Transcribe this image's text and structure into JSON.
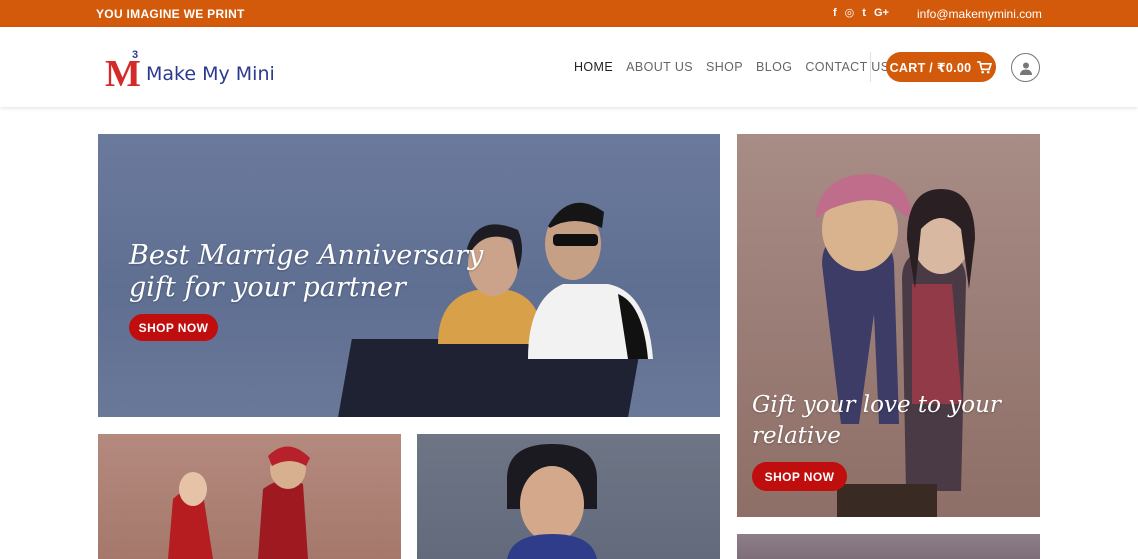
{
  "topbar": {
    "tagline": "YOU IMAGINE WE PRINT",
    "social_icons": [
      "facebook-icon",
      "instagram-icon",
      "twitter-icon",
      "google-plus-icon"
    ],
    "social_glyphs": [
      "f",
      "◎",
      "t",
      "G+"
    ],
    "email": "info@makemymini.com",
    "bg_color": "#d35a0b"
  },
  "logo": {
    "mark": "M",
    "superscript": "3",
    "text": "Make My Mini"
  },
  "nav": {
    "items": [
      {
        "label": "HOME",
        "active": true
      },
      {
        "label": "ABOUT US",
        "active": false
      },
      {
        "label": "SHOP",
        "active": false
      },
      {
        "label": "BLOG",
        "active": false
      },
      {
        "label": "CONTACT US",
        "active": false
      }
    ],
    "cart_label": "CART / ₹0.00",
    "account_icon": "user-icon",
    "accent_color": "#d35a0b"
  },
  "banners": {
    "main": {
      "line1": "Best Marrige Anniversary",
      "line2": "gift for your partner",
      "button": "SHOP NOW"
    },
    "side": {
      "line1": "Gift your love to your",
      "line2": "relative",
      "button": "SHOP NOW"
    },
    "button_color": "#c00d0d"
  }
}
